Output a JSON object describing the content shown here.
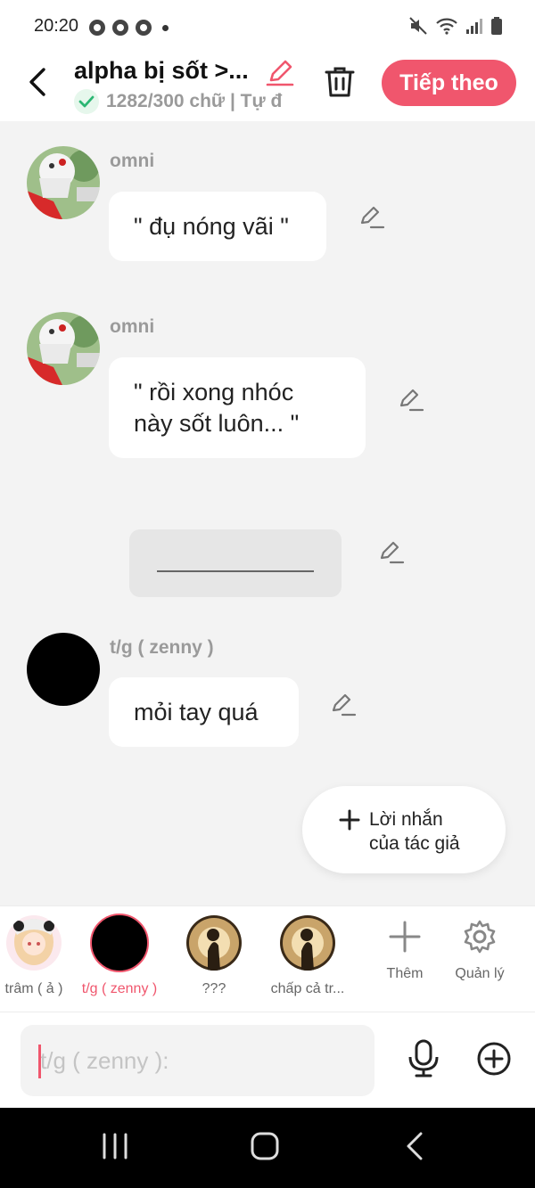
{
  "status": {
    "time": "20:20"
  },
  "header": {
    "title": "alpha bị sốt >...",
    "meta": "1282/300 chữ | Tự đ",
    "next_label": "Tiếp theo"
  },
  "messages": [
    {
      "sender": "omni",
      "text": "\" đụ nóng vãi \""
    },
    {
      "sender": "omni",
      "text": "\" rồi xong nhóc\nnày sốt luôn... \""
    },
    {
      "sender": "t/g ( zenny )",
      "text": "mỏi tay quá"
    }
  ],
  "author_note_label": "Lời nhắn\ncủa tác giả",
  "characters": [
    {
      "name": "trâm ( ả )"
    },
    {
      "name": "t/g ( zenny )"
    },
    {
      "name": "???"
    },
    {
      "name": "chấp cả tr..."
    }
  ],
  "tools": {
    "add_label": "Thêm",
    "manage_label": "Quản lý"
  },
  "input": {
    "placeholder": "t/g ( zenny ):"
  },
  "colors": {
    "accent": "#f0566d",
    "check": "#2bb673"
  }
}
